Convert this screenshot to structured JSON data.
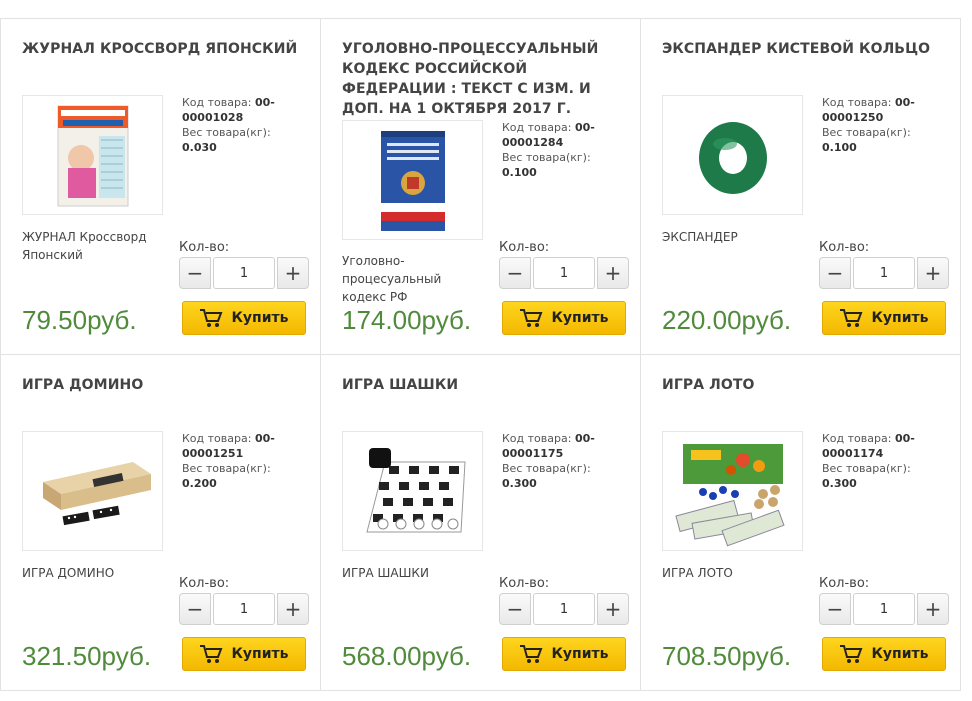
{
  "products": [
    {
      "title": "ЖУРНАЛ КРОССВОРД ЯПОНСКИЙ",
      "code_label": "Код товара:",
      "code": "00-00001028",
      "weight_label": "Вес товара(кг):",
      "weight": "0.030",
      "description": "ЖУРНАЛ Кроссворд Японский",
      "qty_label": "Кол-во:",
      "qty": "1",
      "price": "79.50руб.",
      "buy_label": "Купить",
      "image_icon": "crossword-magazine-icon"
    },
    {
      "title": "УГОЛОВНО-ПРОЦЕССУАЛЬНЫЙ КОДЕКС РОССИЙСКОЙ ФЕДЕРАЦИИ : ТЕКСТ С ИЗМ. И ДОП. НА 1 ОКТЯБРЯ 2017 Г.",
      "code_label": "Код товара:",
      "code": "00-00001284",
      "weight_label": "Вес товара(кг):",
      "weight": "0.100",
      "description": "Уголовно-процесуальный кодекс РФ",
      "qty_label": "Кол-во:",
      "qty": "1",
      "price": "174.00руб.",
      "buy_label": "Купить",
      "image_icon": "law-book-icon"
    },
    {
      "title": "ЭКСПАНДЕР КИСТЕВОЙ КОЛЬЦО",
      "code_label": "Код товара:",
      "code": "00-00001250",
      "weight_label": "Вес товара(кг):",
      "weight": "0.100",
      "description": "ЭКСПАНДЕР",
      "qty_label": "Кол-во:",
      "qty": "1",
      "price": "220.00руб.",
      "buy_label": "Купить",
      "image_icon": "hand-expander-ring-icon"
    },
    {
      "title": "ИГРА ДОМИНО",
      "code_label": "Код товара:",
      "code": "00-00001251",
      "weight_label": "Вес товара(кг):",
      "weight": "0.200",
      "description": "ИГРА ДОМИНО",
      "qty_label": "Кол-во:",
      "qty": "1",
      "price": "321.50руб.",
      "buy_label": "Купить",
      "image_icon": "domino-box-icon"
    },
    {
      "title": "ИГРА ШАШКИ",
      "code_label": "Код товара:",
      "code": "00-00001175",
      "weight_label": "Вес товара(кг):",
      "weight": "0.300",
      "description": "ИГРА ШАШКИ",
      "qty_label": "Кол-во:",
      "qty": "1",
      "price": "568.00руб.",
      "buy_label": "Купить",
      "image_icon": "checkers-board-icon"
    },
    {
      "title": "ИГРА ЛОТО",
      "code_label": "Код товара:",
      "code": "00-00001174",
      "weight_label": "Вес товара(кг):",
      "weight": "0.300",
      "description": "ИГРА ЛОТО",
      "qty_label": "Кол-во:",
      "qty": "1",
      "price": "708.50руб.",
      "buy_label": "Купить",
      "image_icon": "lotto-game-icon"
    }
  ],
  "colors": {
    "price": "#4f8b3a",
    "buy_button": "#ffd51e",
    "border": "#e2e2e2"
  }
}
